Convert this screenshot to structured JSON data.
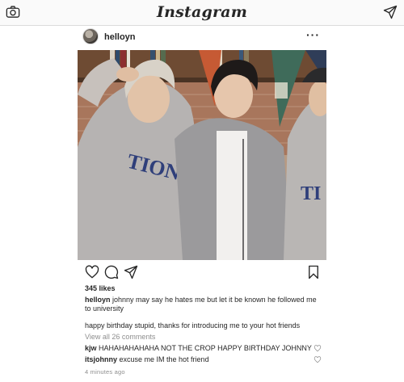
{
  "app": {
    "logo": "Instagram",
    "icons": {
      "left": "camera-icon",
      "right": "direct-send-icon"
    }
  },
  "post": {
    "username": "helloyn",
    "more_label": "···",
    "likes": "345 likes",
    "caption": {
      "username": "helloyn",
      "text": "johnny may say he hates me but let it be known he followed me to university",
      "second_line": "happy birthday stupid, thanks for introducing me to your hot friends"
    },
    "view_comments": "View all 26 comments",
    "comments": [
      {
        "username": "kjw",
        "text": "HAHAHAHAHAHA NOT THE CROP HAPPY BIRTHDAY JOHNNY"
      },
      {
        "username": "itsjohnny",
        "text": "excuse me IM the hot friend"
      }
    ],
    "timestamp": "4 minutes ago",
    "photo_text": {
      "left_hoodie": "TIONII",
      "right_hoodie": "TI"
    }
  },
  "colors": {
    "text": "#262626",
    "muted": "#8e8e8e",
    "border": "#dbdbdb"
  }
}
